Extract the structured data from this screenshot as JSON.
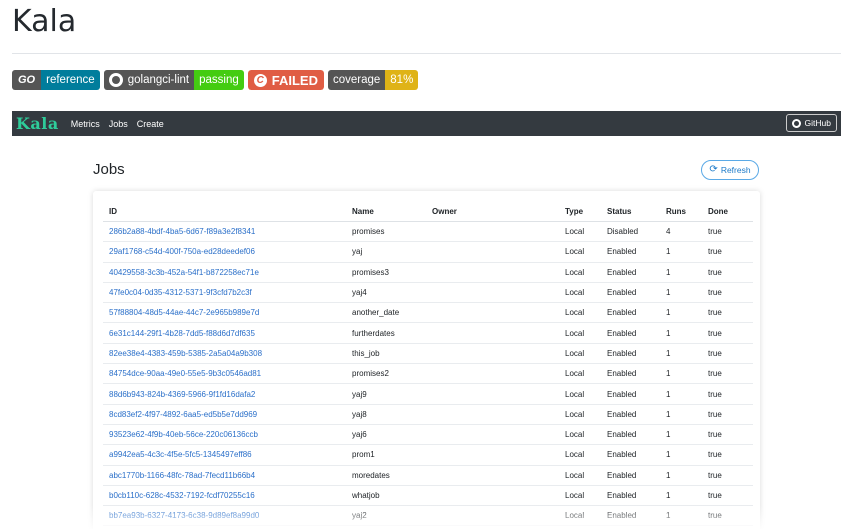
{
  "readme": {
    "title": "Kala"
  },
  "badges": {
    "go_logo": "GO",
    "reference": "reference",
    "lint_label": "golangci-lint",
    "lint_status": "passing",
    "build_status": "FAILED",
    "coverage_label": "coverage",
    "coverage_value": "81%"
  },
  "navbar": {
    "brand": "Kala",
    "links": [
      "Metrics",
      "Jobs",
      "Create"
    ],
    "github_button": "GitHub"
  },
  "page": {
    "title": "Jobs",
    "refresh_button": "Refresh"
  },
  "table": {
    "columns": [
      "ID",
      "Name",
      "Owner",
      "Type",
      "Status",
      "Runs",
      "Done"
    ],
    "rows": [
      [
        "286b2a88-4bdf-4ba5-6d67-f89a3e2f8341",
        "promises",
        "",
        "Local",
        "Disabled",
        "4",
        "true"
      ],
      [
        "29af1768-c54d-400f-750a-ed28deedef06",
        "yaj",
        "",
        "Local",
        "Enabled",
        "1",
        "true"
      ],
      [
        "40429558-3c3b-452a-54f1-b872258ec71e",
        "promises3",
        "",
        "Local",
        "Enabled",
        "1",
        "true"
      ],
      [
        "47fe0c04-0d35-4312-5371-9f3cfd7b2c3f",
        "yaj4",
        "",
        "Local",
        "Enabled",
        "1",
        "true"
      ],
      [
        "57f88804-48d5-44ae-44c7-2e965b989e7d",
        "another_date",
        "",
        "Local",
        "Enabled",
        "1",
        "true"
      ],
      [
        "6e31c144-29f1-4b28-7dd5-f88d6d7df635",
        "furtherdates",
        "",
        "Local",
        "Enabled",
        "1",
        "true"
      ],
      [
        "82ee38e4-4383-459b-5385-2a5a04a9b308",
        "this_job",
        "",
        "Local",
        "Enabled",
        "1",
        "true"
      ],
      [
        "84754dce-90aa-49e0-55e5-9b3c0546ad81",
        "promises2",
        "",
        "Local",
        "Enabled",
        "1",
        "true"
      ],
      [
        "88d6b943-824b-4369-5966-9f1fd16dafa2",
        "yaj9",
        "",
        "Local",
        "Enabled",
        "1",
        "true"
      ],
      [
        "8cd83ef2-4f97-4892-6aa5-ed5b5e7dd969",
        "yaj8",
        "",
        "Local",
        "Enabled",
        "1",
        "true"
      ],
      [
        "93523e62-4f9b-40eb-56ce-220c06136ccb",
        "yaj6",
        "",
        "Local",
        "Enabled",
        "1",
        "true"
      ],
      [
        "a9942ea5-4c3c-4f5e-5fc5-1345497eff86",
        "prom1",
        "",
        "Local",
        "Enabled",
        "1",
        "true"
      ],
      [
        "abc1770b-1166-48fc-78ad-7fecd11b66b4",
        "moredates",
        "",
        "Local",
        "Enabled",
        "1",
        "true"
      ],
      [
        "b0cb110c-628c-4532-7192-fcdf70255c16",
        "whatjob",
        "",
        "Local",
        "Enabled",
        "1",
        "true"
      ],
      [
        "bb7ea93b-6327-4173-6c38-9d89ef8a99d0",
        "yaj2",
        "",
        "Local",
        "Enabled",
        "1",
        "true"
      ]
    ]
  },
  "colors": {
    "navbar_bg": "#343a40",
    "brand": "#2ecc9a",
    "link": "#2a6fc9",
    "badge_reference": "#007d9c",
    "badge_passing": "#4c1",
    "badge_failed": "#e05d44",
    "badge_coverage": "#dfb317"
  }
}
